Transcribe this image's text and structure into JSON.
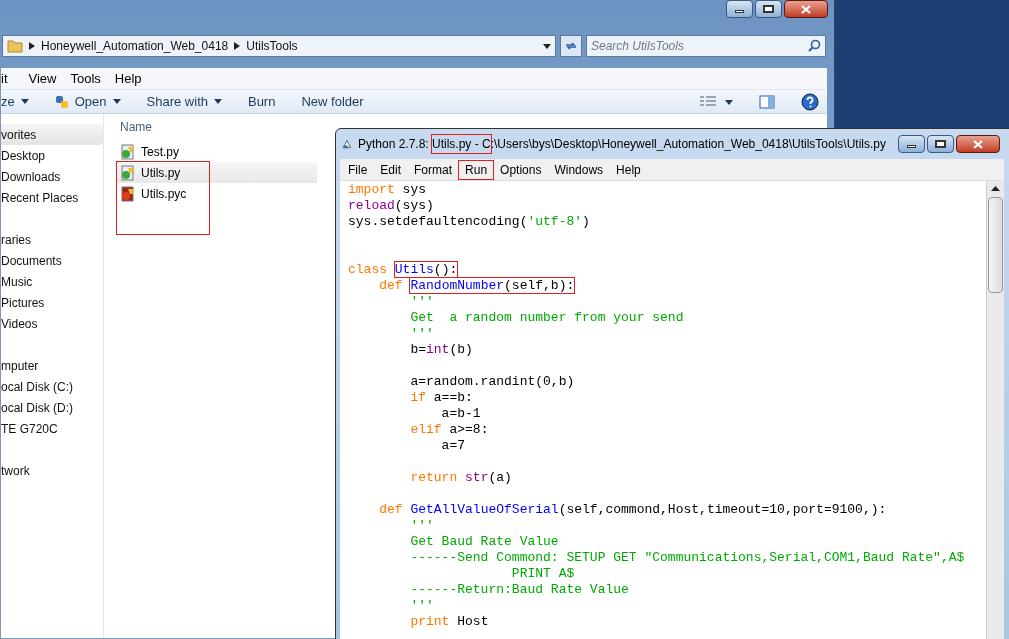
{
  "explorer": {
    "breadcrumb": [
      "Honeywell_Automation_Web_0418",
      "UtilsTools"
    ],
    "search": {
      "placeholder": "Search UtilsTools"
    },
    "menu": [
      "it",
      "View",
      "Tools",
      "Help"
    ],
    "toolbar": [
      {
        "label": "ze",
        "kind": "dropdown"
      },
      {
        "label": "Open",
        "kind": "open"
      },
      {
        "label": "Share with",
        "kind": "dropdown"
      },
      {
        "label": "Burn",
        "kind": "plain"
      },
      {
        "label": "New folder",
        "kind": "plain"
      }
    ],
    "nav_groups": [
      {
        "items": [
          {
            "label": "vorites",
            "selected": true
          },
          {
            "label": "Desktop",
            "selected": false
          },
          {
            "label": "Downloads",
            "selected": false
          },
          {
            "label": "Recent Places",
            "selected": false
          }
        ]
      },
      {
        "items": [
          {
            "label": "raries",
            "selected": false
          },
          {
            "label": "Documents",
            "selected": false
          },
          {
            "label": "Music",
            "selected": false
          },
          {
            "label": "Pictures",
            "selected": false
          },
          {
            "label": "Videos",
            "selected": false
          }
        ]
      },
      {
        "items": [
          {
            "label": "mputer",
            "selected": false
          },
          {
            "label": "ocal Disk (C:)",
            "selected": false
          },
          {
            "label": "ocal Disk (D:)",
            "selected": false
          },
          {
            "label": "TE G720C",
            "selected": false
          }
        ]
      },
      {
        "items": [
          {
            "label": "twork",
            "selected": false
          }
        ]
      }
    ],
    "column": "Name",
    "files": [
      {
        "name": "Test.py",
        "kind": "source",
        "selected": false,
        "boxed": false
      },
      {
        "name": "Utils.py",
        "kind": "source",
        "selected": true,
        "boxed": true
      },
      {
        "name": "Utils.pyc",
        "kind": "compiled",
        "selected": false,
        "boxed": true
      }
    ]
  },
  "editor": {
    "title": [
      {
        "text": "Python 2.7.8: ",
        "boxed": false
      },
      {
        "text": "Utils.py - C",
        "boxed": true
      },
      {
        "text": ":\\Users\\bys\\Desktop\\Honeywell_Automation_Web_0418\\UtilsTools\\Utils.py",
        "boxed": false
      }
    ],
    "menu": [
      {
        "label": "File",
        "boxed": false
      },
      {
        "label": "Edit",
        "boxed": false
      },
      {
        "label": "Format",
        "boxed": false
      },
      {
        "label": "Run",
        "boxed": true
      },
      {
        "label": "Options",
        "boxed": false
      },
      {
        "label": "Windows",
        "boxed": false
      },
      {
        "label": "Help",
        "boxed": false
      }
    ],
    "lines": [
      {
        "kind": "code",
        "tokens": [
          {
            "kind": "keyword",
            "text": "import"
          },
          {
            "kind": "plain",
            "text": " sys"
          }
        ]
      },
      {
        "kind": "code",
        "tokens": [
          {
            "kind": "builtin",
            "text": "reload"
          },
          {
            "kind": "plain",
            "text": "(sys)"
          }
        ]
      },
      {
        "kind": "code",
        "tokens": [
          {
            "kind": "plain",
            "text": "sys.setdefaultencoding("
          },
          {
            "kind": "string",
            "text": "'utf-8'"
          },
          {
            "kind": "plain",
            "text": ")"
          }
        ]
      },
      {
        "kind": "blank"
      },
      {
        "kind": "blank"
      },
      {
        "kind": "code",
        "tokens": [
          {
            "kind": "keyword",
            "text": "class "
          },
          {
            "kind": "name",
            "text": "Utils",
            "boxed": true
          },
          {
            "kind": "plain",
            "text": "():",
            "boxed": true
          }
        ]
      },
      {
        "kind": "code",
        "tokens": [
          {
            "kind": "keyword",
            "text": "    def "
          },
          {
            "kind": "name",
            "text": "RandomNumber",
            "boxed": true
          },
          {
            "kind": "plain",
            "text": "(self,b):",
            "boxed": true
          }
        ]
      },
      {
        "kind": "code",
        "tokens": [
          {
            "kind": "string",
            "text": "        '''"
          }
        ]
      },
      {
        "kind": "code",
        "tokens": [
          {
            "kind": "string",
            "text": "        Get  a random number from your send"
          }
        ]
      },
      {
        "kind": "code",
        "tokens": [
          {
            "kind": "string",
            "text": "        '''"
          }
        ]
      },
      {
        "kind": "code",
        "tokens": [
          {
            "kind": "plain",
            "text": "        b="
          },
          {
            "kind": "builtin",
            "text": "int"
          },
          {
            "kind": "plain",
            "text": "(b)"
          }
        ]
      },
      {
        "kind": "blank"
      },
      {
        "kind": "code",
        "tokens": [
          {
            "kind": "plain",
            "text": "        a=random.randint(0,b)"
          }
        ]
      },
      {
        "kind": "code",
        "tokens": [
          {
            "kind": "keyword",
            "text": "        if"
          },
          {
            "kind": "plain",
            "text": " a==b:"
          }
        ]
      },
      {
        "kind": "code",
        "tokens": [
          {
            "kind": "plain",
            "text": "            a=b-1"
          }
        ]
      },
      {
        "kind": "code",
        "tokens": [
          {
            "kind": "keyword",
            "text": "        elif"
          },
          {
            "kind": "plain",
            "text": " a>=8:"
          }
        ]
      },
      {
        "kind": "code",
        "tokens": [
          {
            "kind": "plain",
            "text": "            a=7"
          }
        ]
      },
      {
        "kind": "blank"
      },
      {
        "kind": "code",
        "tokens": [
          {
            "kind": "keyword",
            "text": "        return "
          },
          {
            "kind": "builtin",
            "text": "str"
          },
          {
            "kind": "plain",
            "text": "(a)"
          }
        ]
      },
      {
        "kind": "blank"
      },
      {
        "kind": "code",
        "tokens": [
          {
            "kind": "keyword",
            "text": "    def "
          },
          {
            "kind": "name",
            "text": "GetAllValueOfSerial"
          },
          {
            "kind": "plain",
            "text": "(self,commond,Host,timeout=10,port=9100,):"
          }
        ]
      },
      {
        "kind": "code",
        "tokens": [
          {
            "kind": "string",
            "text": "        '''"
          }
        ]
      },
      {
        "kind": "code",
        "tokens": [
          {
            "kind": "string",
            "text": "        Get Baud Rate Value"
          }
        ]
      },
      {
        "kind": "code",
        "tokens": [
          {
            "kind": "string",
            "text": "        ------Send Commond: SETUP GET \"Communications,Serial,COM1,Baud Rate\",A$"
          }
        ]
      },
      {
        "kind": "code",
        "tokens": [
          {
            "kind": "string",
            "text": "                     PRINT A$"
          }
        ]
      },
      {
        "kind": "code",
        "tokens": [
          {
            "kind": "string",
            "text": "        ------Return:Baud Rate Value"
          }
        ]
      },
      {
        "kind": "code",
        "tokens": [
          {
            "kind": "string",
            "text": "        '''"
          }
        ]
      },
      {
        "kind": "code",
        "tokens": [
          {
            "kind": "keyword",
            "text": "        print"
          },
          {
            "kind": "plain",
            "text": " Host"
          }
        ]
      }
    ]
  }
}
